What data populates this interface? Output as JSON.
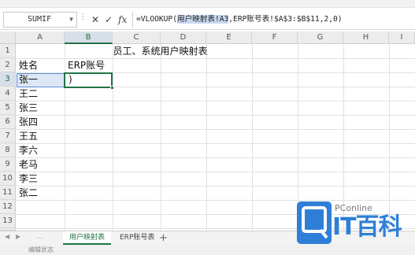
{
  "formula_bar": {
    "name_box": "SUMIF",
    "formula_prefix": "=VLOOKUP(",
    "formula_ref": "用户映射表!A3",
    "formula_suffix": ",ERP账号表!$A$3:$B$11,2,0)",
    "cancel_glyph": "✕",
    "enter_glyph": "✓",
    "fx_label": "fx"
  },
  "columns": [
    "A",
    "B",
    "C",
    "D",
    "E",
    "F",
    "G",
    "H",
    "I"
  ],
  "rows": [
    "1",
    "2",
    "3",
    "4",
    "5",
    "6",
    "7",
    "8",
    "9",
    "10",
    "11",
    "12",
    "13",
    "14"
  ],
  "sheet": {
    "title": "员工、系统用户映射表",
    "header_name": "姓名",
    "header_account": "ERP账号",
    "editing_text": ")",
    "names": [
      "张一",
      "王二",
      "张三",
      "张四",
      "王五",
      "李六",
      "老马",
      "李三",
      "张二"
    ]
  },
  "tabs": [
    "用户映射表",
    "ERP账号表"
  ],
  "tab_add_label": "+",
  "status": {
    "text": "编辑状态"
  },
  "watermark": {
    "brand": "PConline",
    "title": "IT百科"
  },
  "colors": {
    "accent": "#217346",
    "selection": "#dde7f6",
    "watermark_blue": "#2f7fd8"
  },
  "icons": [
    "cancel-icon",
    "enter-icon",
    "function-icon",
    "chevron-down-icon",
    "prev-sheet-icon",
    "next-sheet-icon"
  ]
}
